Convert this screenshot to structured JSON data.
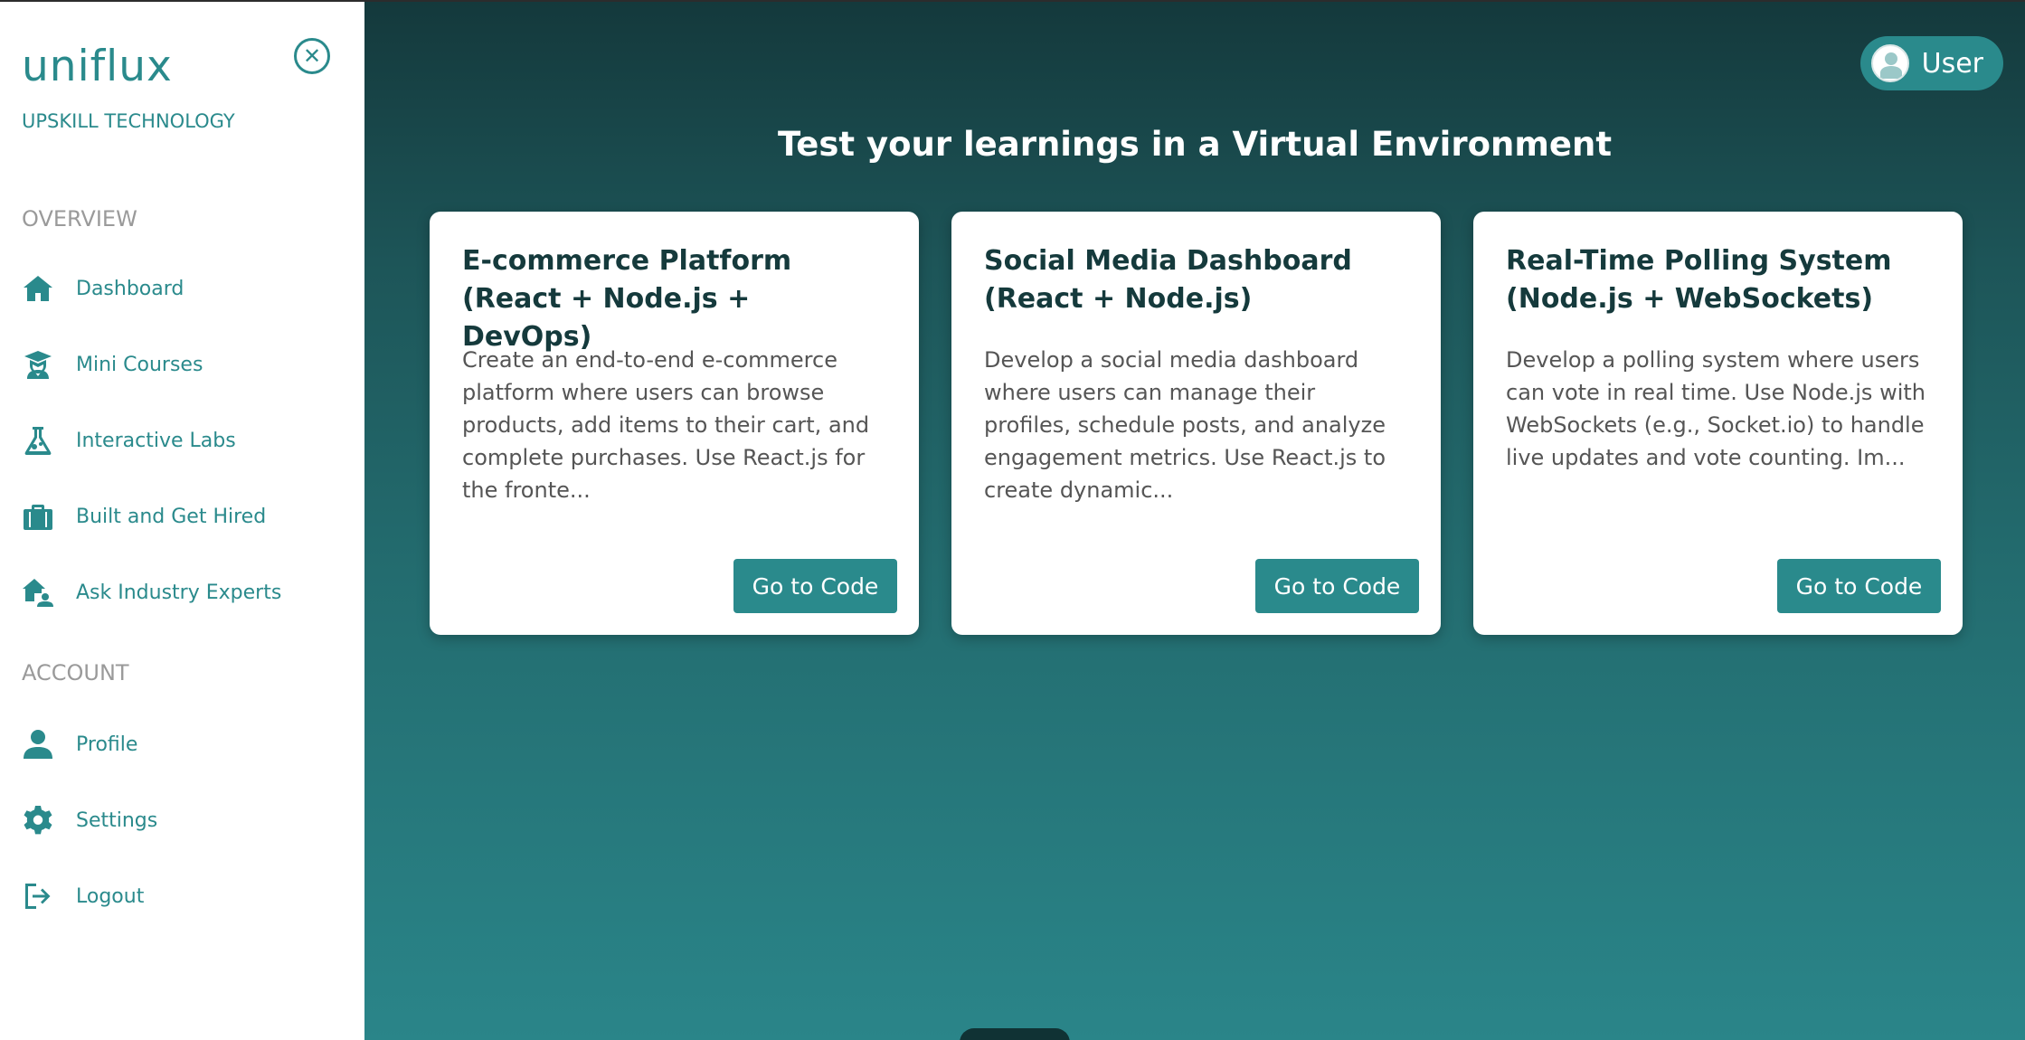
{
  "sidebar": {
    "brand": "uniflux",
    "tagline": "UPSKILL TECHNOLOGY",
    "sections": {
      "overview": "OVERVIEW",
      "account": "ACCOUNT"
    },
    "overview_items": [
      {
        "label": "Dashboard",
        "icon": "home-icon"
      },
      {
        "label": "Mini Courses",
        "icon": "graduate-icon"
      },
      {
        "label": "Interactive Labs",
        "icon": "flask-icon"
      },
      {
        "label": "Built and Get Hired",
        "icon": "briefcase-icon"
      },
      {
        "label": "Ask Industry Experts",
        "icon": "house-user-icon"
      }
    ],
    "account_items": [
      {
        "label": "Profile",
        "icon": "user-icon"
      },
      {
        "label": "Settings",
        "icon": "gear-icon"
      },
      {
        "label": "Logout",
        "icon": "logout-icon"
      }
    ],
    "close_icon": "close-circle-icon"
  },
  "header": {
    "user_label": "User"
  },
  "main": {
    "title": "Test your learnings in a Virtual Environment",
    "cards": [
      {
        "title": "E-commerce Platform (React + Node.js + DevOps)",
        "description": "Create an end-to-end e-commerce platform where users can browse products, add items to their cart, and complete purchases. Use React.js for the fronte...",
        "button": "Go to Code"
      },
      {
        "title": "Social Media Dashboard (React + Node.js)",
        "description": "Develop a social media dashboard where users can manage their profiles, schedule posts, and analyze engagement metrics. Use React.js to create dynamic...",
        "button": "Go to Code"
      },
      {
        "title": "Real-Time Polling System (Node.js + WebSockets)",
        "description": "Develop a polling system where users can vote in real time. Use Node.js with WebSockets (e.g., Socket.io) to handle live updates and vote counting. Im...",
        "button": "Go to Code"
      }
    ]
  },
  "colors": {
    "accent": "#2a8a8c",
    "title_dark": "#153a3c"
  }
}
